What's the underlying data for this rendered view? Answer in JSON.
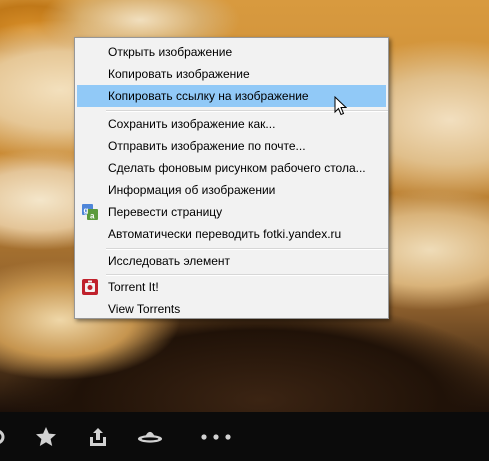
{
  "context_menu": {
    "items": [
      {
        "label": "Открыть изображение"
      },
      {
        "label": "Копировать изображение"
      },
      {
        "label": "Копировать ссылку на изображение",
        "highlighted": true
      },
      {
        "label": "Сохранить изображение как..."
      },
      {
        "label": "Отправить изображение по почте..."
      },
      {
        "label": "Сделать фоновым рисунком рабочего стола..."
      },
      {
        "label": "Информация об изображении"
      },
      {
        "label": "Перевести страницу",
        "icon": "translate-icon"
      },
      {
        "label": "Автоматически переводить fotki.yandex.ru"
      },
      {
        "label": "Исследовать элемент"
      },
      {
        "label": "Torrent It!",
        "icon": "torrent-icon"
      },
      {
        "label": "View Torrents"
      }
    ]
  },
  "toolbar": {
    "icons": [
      "star-icon",
      "share-icon",
      "ufo-icon",
      "more-icon"
    ]
  },
  "colors": {
    "highlight": "#91c9f7",
    "menu_bg": "#f2f2f2",
    "toolbar_bg": "#0b0b0b"
  }
}
